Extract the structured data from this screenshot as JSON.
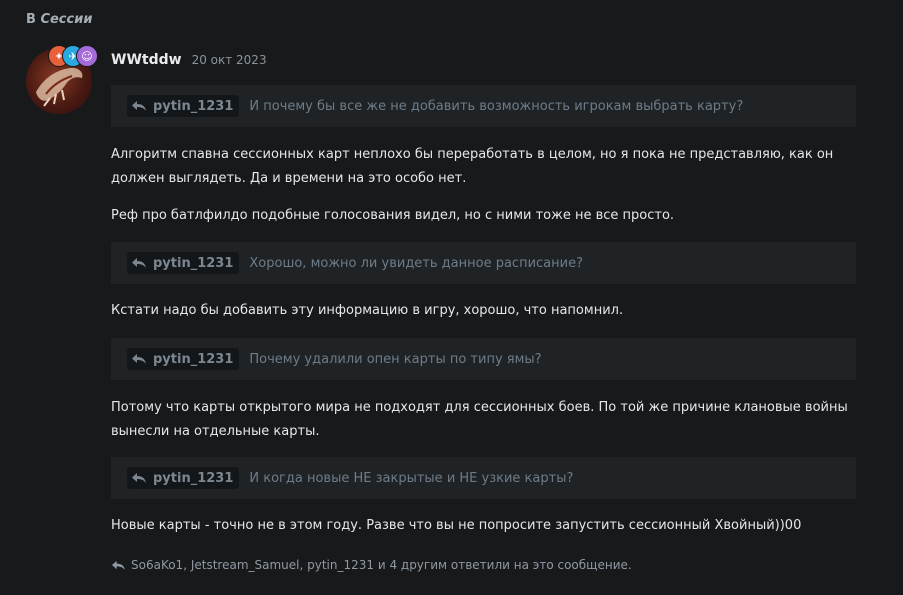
{
  "context": {
    "prefix": "В",
    "section": "Сессии"
  },
  "post": {
    "username": "WWtddw",
    "date": "20 окт 2023",
    "badges": [
      {
        "icon": "flame-badge-icon",
        "color": "#e8603c",
        "glyph": "✦"
      },
      {
        "icon": "rocket-badge-icon",
        "color": "#2aa8e0",
        "glyph": "✈"
      },
      {
        "icon": "graduate-badge-icon",
        "color": "#a46ad8",
        "glyph": "☺"
      }
    ],
    "quotes": [
      {
        "user": "pytin_1231",
        "text": "И почему бы все же не добавить возможность игрокам выбрать карту?"
      },
      {
        "user": "pytin_1231",
        "text": "Хорошо, можно ли увидеть данное расписание?"
      },
      {
        "user": "pytin_1231",
        "text": "Почему удалили опен карты по типу ямы?"
      },
      {
        "user": "pytin_1231",
        "text": "И когда новые НЕ закрытые и НЕ узкие карты?"
      }
    ],
    "paragraphs": [
      "Алгоритм спавна сессионных карт неплохо бы переработать в целом, но я пока не представляю, как он должен выглядеть. Да и времени на это особо нет.",
      "Реф про батлфилдо подобные голосования видел, но с ними тоже не все просто.",
      "Кстати надо бы добавить эту информацию в игру, хорошо, что напомнил.",
      "Потому что карты открытого мира не подходят для сессионных боев. По той же причине клановые войны вынесли на отдельные карты.",
      "Новые карты - точно не в этом году. Разве что вы не попросите запустить сессионный Хвойный))00"
    ],
    "replies_summary": "So6aKo1, Jetstream_Samuel, pytin_1231 и 4 другим ответили на это сообщение."
  },
  "colors": {
    "background": "#17191b",
    "quote_bg": "#1f2326",
    "quote_text": "#6e7c88"
  }
}
